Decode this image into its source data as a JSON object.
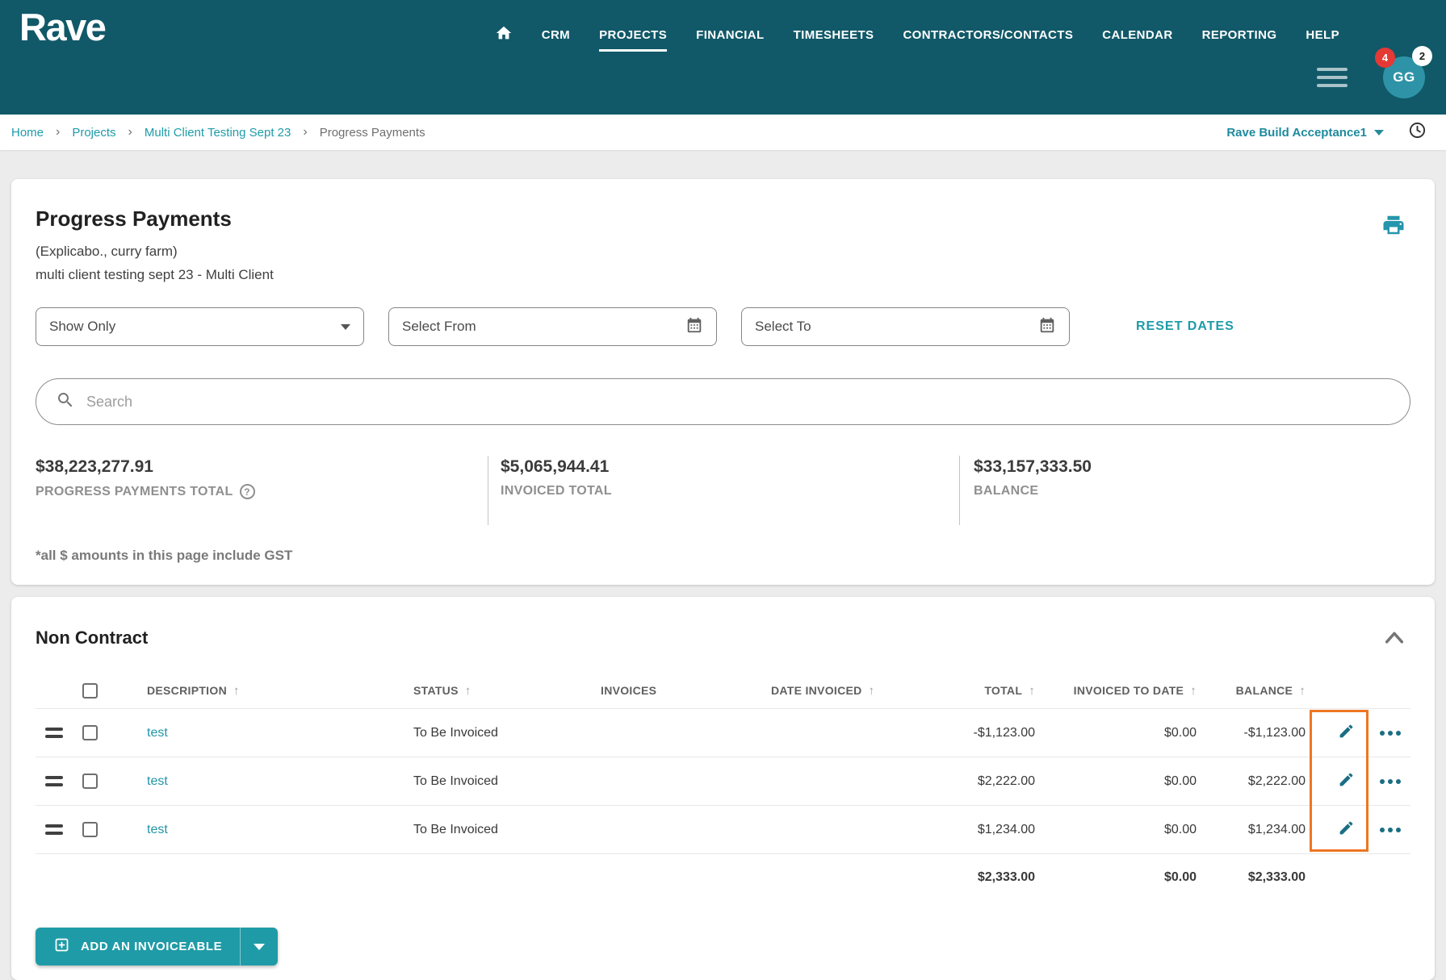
{
  "brand": {
    "name": "Rave"
  },
  "nav": {
    "items": [
      "CRM",
      "PROJECTS",
      "FINANCIAL",
      "TIMESHEETS",
      "CONTRACTORS/CONTACTS",
      "CALENDAR",
      "REPORTING",
      "HELP"
    ],
    "active": "PROJECTS"
  },
  "user": {
    "initials": "GG",
    "notification_count": "4",
    "message_count": "2"
  },
  "breadcrumb": {
    "items": [
      "Home",
      "Projects",
      "Multi Client Testing Sept 23",
      "Progress Payments"
    ],
    "workspace": "Rave Build Acceptance1"
  },
  "page": {
    "title": "Progress Payments",
    "subtitle1": "(Explicabo., curry farm)",
    "subtitle2": "multi client testing sept 23 - Multi Client"
  },
  "filters": {
    "show_only": "Show Only",
    "select_from": "Select From",
    "select_to": "Select To",
    "reset_dates": "RESET DATES"
  },
  "search": {
    "placeholder": "Search"
  },
  "summary": {
    "progress_total": {
      "value": "$38,223,277.91",
      "label": "PROGRESS PAYMENTS TOTAL"
    },
    "invoiced_total": {
      "value": "$5,065,944.41",
      "label": "INVOICED TOTAL"
    },
    "balance": {
      "value": "$33,157,333.50",
      "label": "BALANCE"
    },
    "note": "*all $ amounts in this page include GST"
  },
  "section": {
    "title": "Non Contract"
  },
  "table": {
    "columns": {
      "description": "DESCRIPTION",
      "status": "STATUS",
      "invoices": "INVOICES",
      "date_invoiced": "DATE INVOICED",
      "total": "TOTAL",
      "invoiced_to_date": "INVOICED TO DATE",
      "balance": "BALANCE"
    },
    "rows": [
      {
        "description": "test",
        "status": "To Be Invoiced",
        "invoices": "",
        "date_invoiced": "",
        "total": "-$1,123.00",
        "invoiced_to_date": "$0.00",
        "balance": "-$1,123.00"
      },
      {
        "description": "test",
        "status": "To Be Invoiced",
        "invoices": "",
        "date_invoiced": "",
        "total": "$2,222.00",
        "invoiced_to_date": "$0.00",
        "balance": "$2,222.00"
      },
      {
        "description": "test",
        "status": "To Be Invoiced",
        "invoices": "",
        "date_invoiced": "",
        "total": "$1,234.00",
        "invoiced_to_date": "$0.00",
        "balance": "$1,234.00"
      }
    ],
    "totals": {
      "total": "$2,333.00",
      "invoiced_to_date": "$0.00",
      "balance": "$2,333.00"
    }
  },
  "actions": {
    "add_invoiceable": "ADD AN INVOICEABLE"
  },
  "icons": {
    "sort_arrow": "↑",
    "breadcrumb_separator": "›",
    "help": "?"
  },
  "colors": {
    "header": "#115968",
    "accent": "#1E9BA8",
    "highlight": "#ED7622",
    "badge_red": "#E53935"
  }
}
